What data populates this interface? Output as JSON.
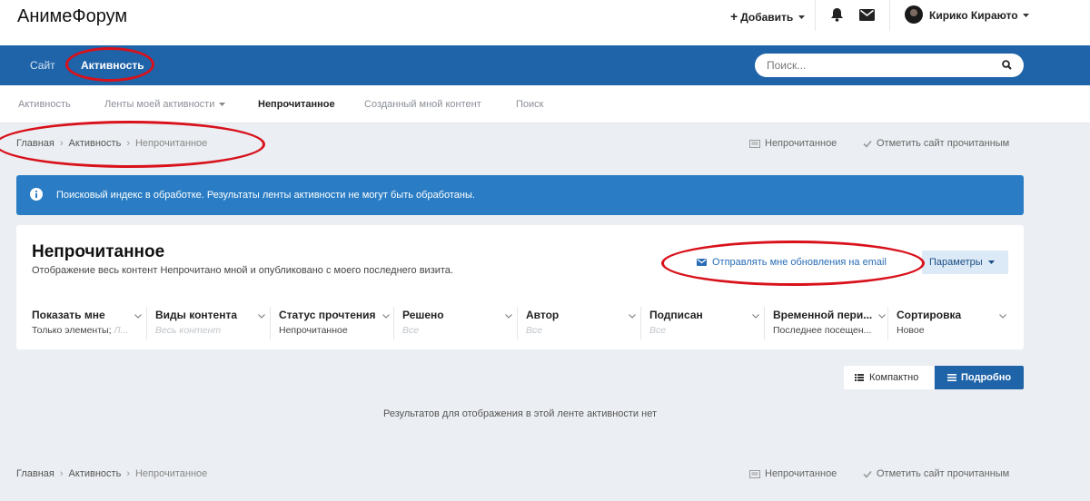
{
  "header": {
    "site_title": "АнимеФорум",
    "add_label": "Добавить",
    "user_name": "Кирико Кираюто"
  },
  "nav": {
    "items": [
      {
        "label": "Сайт"
      },
      {
        "label": "Активность"
      }
    ],
    "search_placeholder": "Поиск..."
  },
  "subnav": {
    "items": [
      {
        "label": "Активность"
      },
      {
        "label": "Ленты моей активности"
      },
      {
        "label": "Непрочитанное"
      },
      {
        "label": "Созданный мной контент"
      },
      {
        "label": "Поиск"
      }
    ]
  },
  "breadcrumb": {
    "items": [
      "Главная",
      "Активность",
      "Непрочитанное"
    ],
    "unread_action": "Непрочитанное",
    "mark_read_action": "Отметить сайт прочитанным"
  },
  "banner": {
    "text": "Поисковый индекс в обработке. Результаты ленты активности не могут быть обработаны."
  },
  "card": {
    "title": "Непрочитанное",
    "description": "Отображение весь контент Непрочитано мной и опубликовано с моего последнего визита.",
    "follow_label": "Отправлять мне обновления на email",
    "params_label": "Параметры"
  },
  "filters": [
    {
      "label": "Показать мне",
      "value": "Только элементы;",
      "value_extra": "Л..."
    },
    {
      "label": "Виды контента",
      "value": "Весь контент"
    },
    {
      "label": "Статус прочтения",
      "value": "Непрочитанное"
    },
    {
      "label": "Решено",
      "value": "Все"
    },
    {
      "label": "Автор",
      "value": "Все"
    },
    {
      "label": "Подписан",
      "value": "Все"
    },
    {
      "label": "Временной пери...",
      "value": "Последнее посещен..."
    },
    {
      "label": "Сортировка",
      "value": "Новое"
    }
  ],
  "view_toggle": {
    "compact_label": "Компактно",
    "detailed_label": "Подробно"
  },
  "empty_message": "Результатов для отображения в этой ленте активности нет",
  "colors": {
    "nav_blue": "#1f63a8",
    "banner_blue": "#2a7dc4",
    "annotation_red": "#d8111b"
  }
}
